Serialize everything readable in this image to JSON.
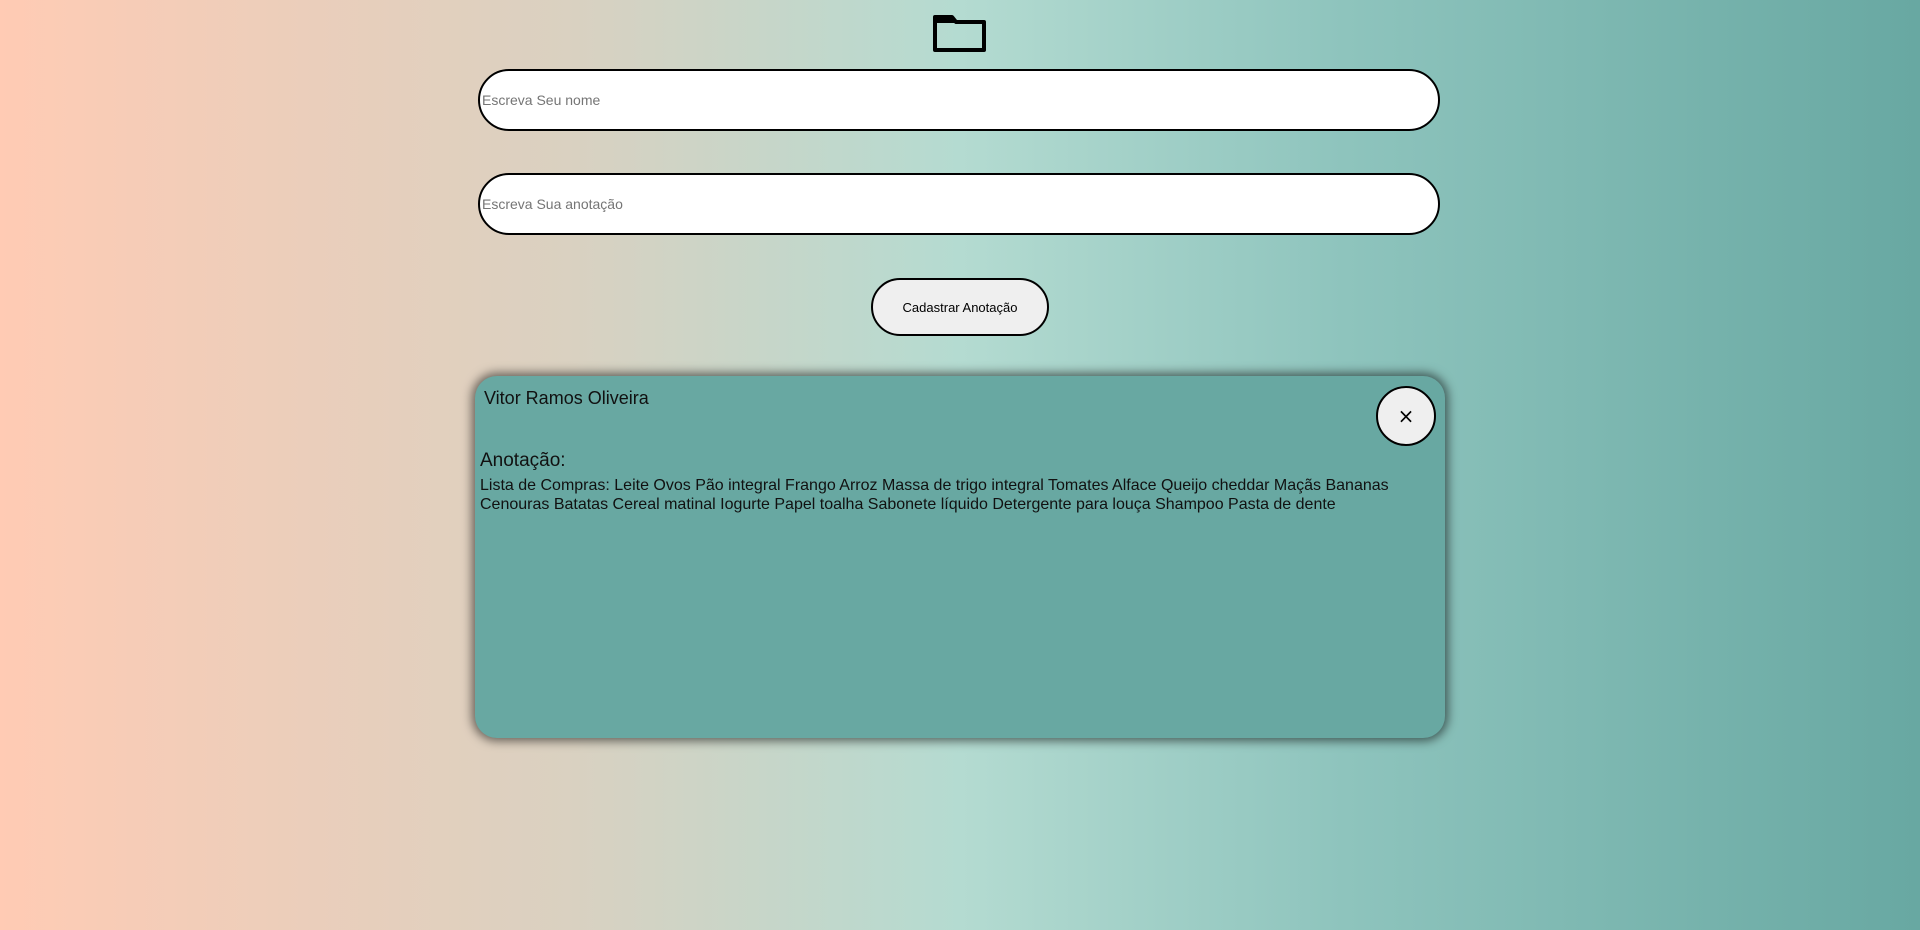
{
  "header": {
    "icon": "folder-icon"
  },
  "form": {
    "name_placeholder": "Escreva Seu nome",
    "name_value": "",
    "note_placeholder": "Escreva Sua anotação",
    "note_value": "",
    "submit_label": "Cadastrar Anotação"
  },
  "notes": [
    {
      "author": "Vitor Ramos Oliveira",
      "close_label": "×",
      "heading": "Anotação:",
      "body": "Lista de Compras: Leite Ovos Pão integral Frango Arroz Massa de trigo integral Tomates Alface Queijo cheddar Maçãs Bananas Cenouras Batatas Cereal matinal Iogurte Papel toalha Sabonete líquido Detergente para louça Shampoo Pasta de dente"
    }
  ],
  "colors": {
    "gradient_start": "#ffcbb4",
    "gradient_middle": "#b4dbd1",
    "gradient_end": "#68a8a2",
    "card_background": "#68a8a2",
    "button_background": "#efefef"
  }
}
